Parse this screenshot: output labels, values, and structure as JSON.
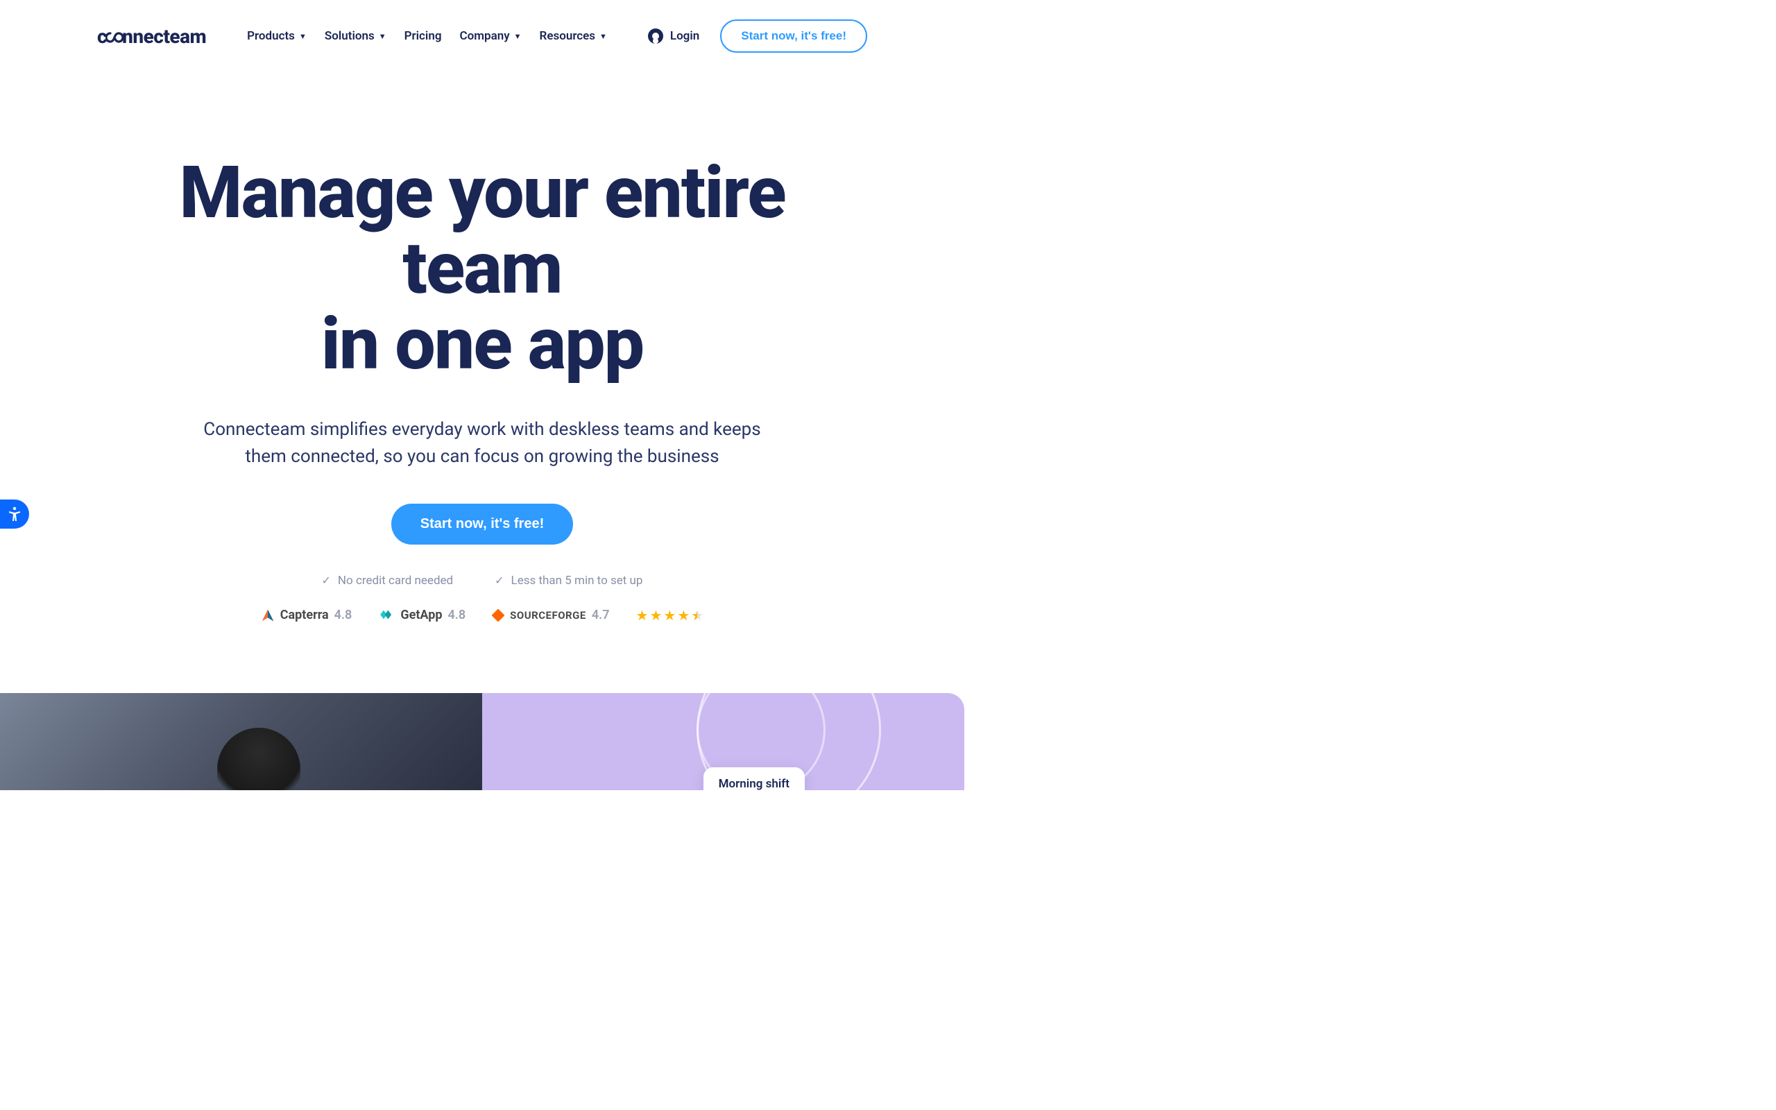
{
  "brand": "connecteam",
  "nav": {
    "items": [
      {
        "label": "Products",
        "hasDropdown": true
      },
      {
        "label": "Solutions",
        "hasDropdown": true
      },
      {
        "label": "Pricing",
        "hasDropdown": false
      },
      {
        "label": "Company",
        "hasDropdown": true
      },
      {
        "label": "Resources",
        "hasDropdown": true
      }
    ]
  },
  "header": {
    "login": "Login",
    "cta": "Start now, it's free!"
  },
  "hero": {
    "title_line1": "Manage your entire team",
    "title_line2": "in one app",
    "subtitle": "Connecteam simplifies everyday work with deskless teams and keeps them connected, so you can focus on growing the business",
    "cta": "Start now, it's free!"
  },
  "benefits": [
    "No credit card needed",
    "Less than 5 min to set up"
  ],
  "ratings": [
    {
      "name": "Capterra",
      "score": "4.8"
    },
    {
      "name": "GetApp",
      "score": "4.8"
    },
    {
      "name": "SOURCEFORGE",
      "score": "4.7"
    }
  ],
  "shift_card": "Morning shift",
  "colors": {
    "primary": "#2f9bff",
    "text": "#1a2654",
    "purple": "#cbb9f2",
    "star": "#ffb400"
  }
}
